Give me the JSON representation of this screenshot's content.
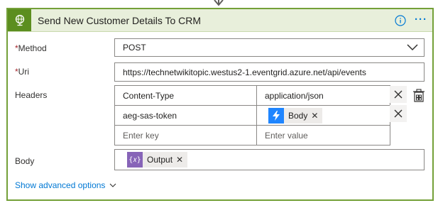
{
  "action": {
    "title": "Send New Customer Details To CRM",
    "icon": "globe-icon"
  },
  "header_actions": {
    "info_icon": "info-icon",
    "more_label": "···"
  },
  "method": {
    "label": "Method",
    "required_mark": "*",
    "value": "POST"
  },
  "uri": {
    "label": "Uri",
    "required_mark": "*",
    "value": "https://technetwikitopic.westus2-1.eventgrid.azure.net/api/events"
  },
  "headers": {
    "label": "Headers",
    "rows": [
      {
        "key": "Content-Type",
        "value": "application/json"
      },
      {
        "key": "aeg-sas-token",
        "token": {
          "label": "Body",
          "icon": "lightning-icon",
          "color": "#1f85ff"
        }
      }
    ],
    "key_placeholder": "Enter key",
    "value_placeholder": "Enter value"
  },
  "body": {
    "label": "Body",
    "token": {
      "label": "Output",
      "icon": "expression-icon",
      "color": "#8764b8"
    }
  },
  "advanced": {
    "label": "Show advanced options"
  },
  "colors": {
    "accent": "#74a038",
    "header_bg": "#e8efdb",
    "link": "#0078d4"
  }
}
